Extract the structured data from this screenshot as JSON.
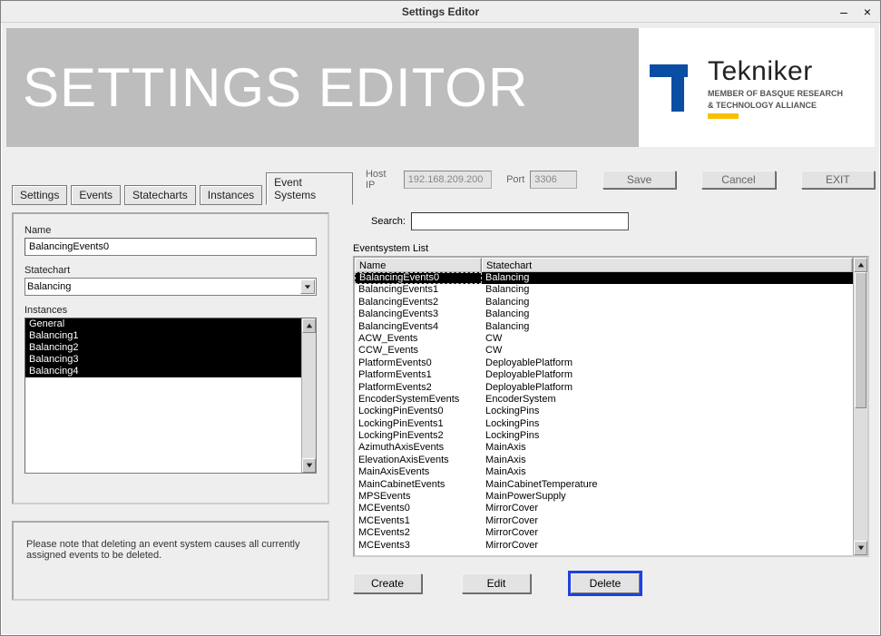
{
  "window": {
    "title": "Settings Editor"
  },
  "hero": {
    "title": "SETTINGS EDITOR",
    "brand": "Tekniker",
    "subline1": "MEMBER OF BASQUE RESEARCH",
    "subline2": "& TECHNOLOGY ALLIANCE"
  },
  "conn": {
    "hostip_label": "Host IP",
    "hostip_value": "192.168.209.200",
    "port_label": "Port",
    "port_value": "3306",
    "save": "Save",
    "cancel": "Cancel",
    "exit": "EXIT"
  },
  "tabs": {
    "settings": "Settings",
    "events": "Events",
    "statecharts": "Statecharts",
    "instances": "Instances",
    "event_systems": "Event Systems"
  },
  "form": {
    "name_label": "Name",
    "name_value": "BalancingEvents0",
    "statechart_label": "Statechart",
    "statechart_value": "Balancing",
    "instances_label": "Instances",
    "instances": [
      "General",
      "Balancing1",
      "Balancing2",
      "Balancing3",
      "Balancing4"
    ]
  },
  "note": "Please note that deleting an event system causes all currently assigned events to be deleted.",
  "search": {
    "label": "Search:",
    "value": ""
  },
  "grid": {
    "label": "Eventsystem List",
    "col1": "Name",
    "col2": "Statechart",
    "selected_index": 0,
    "rows": [
      {
        "n": "BalancingEvents0",
        "s": "Balancing"
      },
      {
        "n": "BalancingEvents1",
        "s": "Balancing"
      },
      {
        "n": "BalancingEvents2",
        "s": "Balancing"
      },
      {
        "n": "BalancingEvents3",
        "s": "Balancing"
      },
      {
        "n": "BalancingEvents4",
        "s": "Balancing"
      },
      {
        "n": "ACW_Events",
        "s": "CW"
      },
      {
        "n": "CCW_Events",
        "s": "CW"
      },
      {
        "n": "PlatformEvents0",
        "s": "DeployablePlatform"
      },
      {
        "n": "PlatformEvents1",
        "s": "DeployablePlatform"
      },
      {
        "n": "PlatformEvents2",
        "s": "DeployablePlatform"
      },
      {
        "n": "EncoderSystemEvents",
        "s": "EncoderSystem"
      },
      {
        "n": "LockingPinEvents0",
        "s": "LockingPins"
      },
      {
        "n": "LockingPinEvents1",
        "s": "LockingPins"
      },
      {
        "n": "LockingPinEvents2",
        "s": "LockingPins"
      },
      {
        "n": "AzimuthAxisEvents",
        "s": "MainAxis"
      },
      {
        "n": "ElevationAxisEvents",
        "s": "MainAxis"
      },
      {
        "n": "MainAxisEvents",
        "s": "MainAxis"
      },
      {
        "n": "MainCabinetEvents",
        "s": "MainCabinetTemperature"
      },
      {
        "n": "MPSEvents",
        "s": "MainPowerSupply"
      },
      {
        "n": "MCEvents0",
        "s": "MirrorCover"
      },
      {
        "n": "MCEvents1",
        "s": "MirrorCover"
      },
      {
        "n": "MCEvents2",
        "s": "MirrorCover"
      },
      {
        "n": "MCEvents3",
        "s": "MirrorCover"
      }
    ]
  },
  "actions": {
    "create": "Create",
    "edit": "Edit",
    "delete": "Delete"
  }
}
